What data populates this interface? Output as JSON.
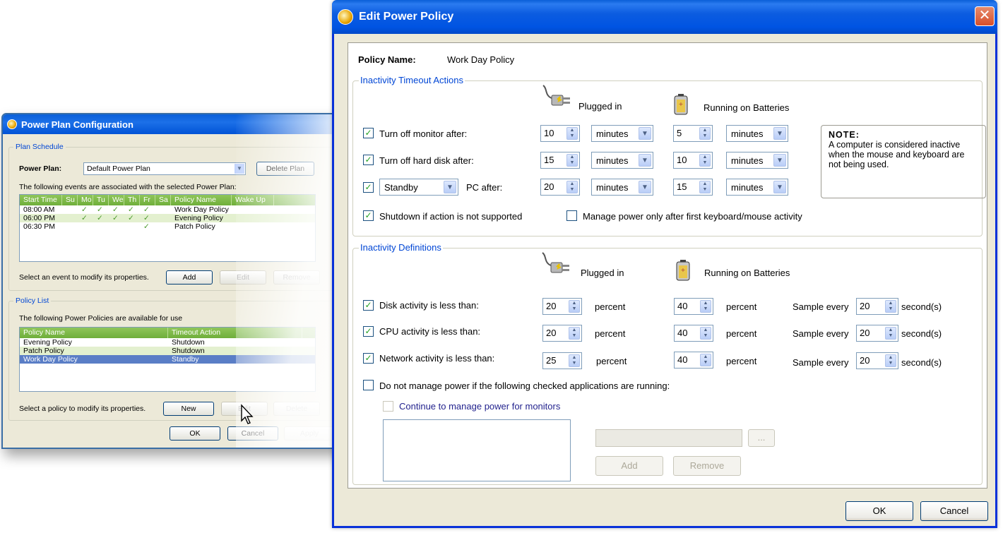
{
  "bg_window": {
    "title": "Power Plan Configuration",
    "plan_schedule": {
      "group_title": "Plan Schedule",
      "power_plan_label": "Power Plan:",
      "power_plan_value": "Default Power Plan",
      "delete_plan_label": "Delete Plan",
      "events_text": "The following events are associated with the selected Power Plan:",
      "columns": [
        "Start Time",
        "Su",
        "Mo",
        "Tu",
        "We",
        "Th",
        "Fr",
        "Sa",
        "Policy Name",
        "Wake Up"
      ],
      "rows": [
        {
          "start": "08:00 AM",
          "days": [
            "",
            "✓",
            "✓",
            "✓",
            "✓",
            "✓",
            ""
          ],
          "policy": "Work Day Policy",
          "wake": ""
        },
        {
          "start": "06:00 PM",
          "days": [
            "",
            "✓",
            "✓",
            "✓",
            "✓",
            "✓",
            ""
          ],
          "policy": "Evening Policy",
          "wake": ""
        },
        {
          "start": "06:30 PM",
          "days": [
            "",
            "",
            "",
            "",
            "",
            "✓",
            ""
          ],
          "policy": "Patch Policy",
          "wake": ""
        }
      ],
      "select_event_text": "Select an event to modify its properties.",
      "add_label": "Add",
      "edit_label": "Edit",
      "remove_label": "Remove"
    },
    "policy_list": {
      "group_title": "Policy List",
      "available_text": "The following Power Policies are available for use",
      "columns": [
        "Policy Name",
        "Timeout Action"
      ],
      "rows": [
        {
          "name": "Evening Policy",
          "action": "Shutdown"
        },
        {
          "name": "Patch Policy",
          "action": "Shutdown"
        },
        {
          "name": "Work Day Policy",
          "action": "Standby"
        }
      ],
      "select_policy_text": "Select a policy to modify its properties.",
      "new_label": "New",
      "edit_label": "Edit",
      "delete_label": "Delete"
    },
    "ok_label": "OK",
    "cancel_label": "Cancel",
    "apply_label": "Apply"
  },
  "dialog": {
    "title": "Edit Power Policy",
    "close_symbol": "✕",
    "policy_name_label": "Policy Name:",
    "policy_name_value": "Work Day Policy",
    "timeout_group": {
      "title": "Inactivity Timeout Actions",
      "plugged_in_label": "Plugged in",
      "batteries_label": "Running on Batteries",
      "rows": [
        {
          "checked": true,
          "label": "Turn off monitor after:",
          "plugged_value": "10",
          "plugged_unit": "minutes",
          "battery_value": "5",
          "battery_unit": "minutes"
        },
        {
          "checked": true,
          "label": "Turn off hard disk after:",
          "plugged_value": "15",
          "plugged_unit": "minutes",
          "battery_value": "10",
          "battery_unit": "minutes"
        },
        {
          "checked": true,
          "action": "Standby",
          "label": "PC after:",
          "plugged_value": "20",
          "plugged_unit": "minutes",
          "battery_value": "15",
          "battery_unit": "minutes"
        }
      ],
      "shutdown_checked": true,
      "shutdown_label": "Shutdown if action is not supported",
      "manage_after_checked": false,
      "manage_after_label": "Manage power only after first keyboard/mouse activity",
      "note_title": "NOTE:",
      "note_text": "A computer is considered inactive when the mouse and keyboard are not being used."
    },
    "definitions_group": {
      "title": "Inactivity Definitions",
      "plugged_in_label": "Plugged in",
      "batteries_label": "Running on Batteries",
      "rows": [
        {
          "checked": true,
          "label": "Disk activity is less than:",
          "plugged_value": "20",
          "plugged_unit": "percent",
          "battery_value": "40",
          "battery_unit": "percent",
          "sample_label": "Sample every",
          "sample_value": "20",
          "sample_unit": "second(s)"
        },
        {
          "checked": true,
          "label": "CPU activity is less than:",
          "plugged_value": "20",
          "plugged_unit": "percent",
          "battery_value": "40",
          "battery_unit": "percent",
          "sample_label": "Sample every",
          "sample_value": "20",
          "sample_unit": "second(s)"
        },
        {
          "checked": true,
          "label": "Network activity is less than:",
          "plugged_value": "25",
          "plugged_unit": "percent",
          "battery_value": "40",
          "battery_unit": "percent",
          "sample_label": "Sample every",
          "sample_value": "20",
          "sample_unit": "second(s)"
        }
      ],
      "apps_checked": false,
      "apps_label": "Do not manage power if the following checked applications are running:",
      "monitors_checked": false,
      "monitors_label": "Continue to manage power for monitors",
      "browse_label": "...",
      "add_label": "Add",
      "remove_label": "Remove"
    },
    "ok_label": "OK",
    "cancel_label": "Cancel"
  }
}
